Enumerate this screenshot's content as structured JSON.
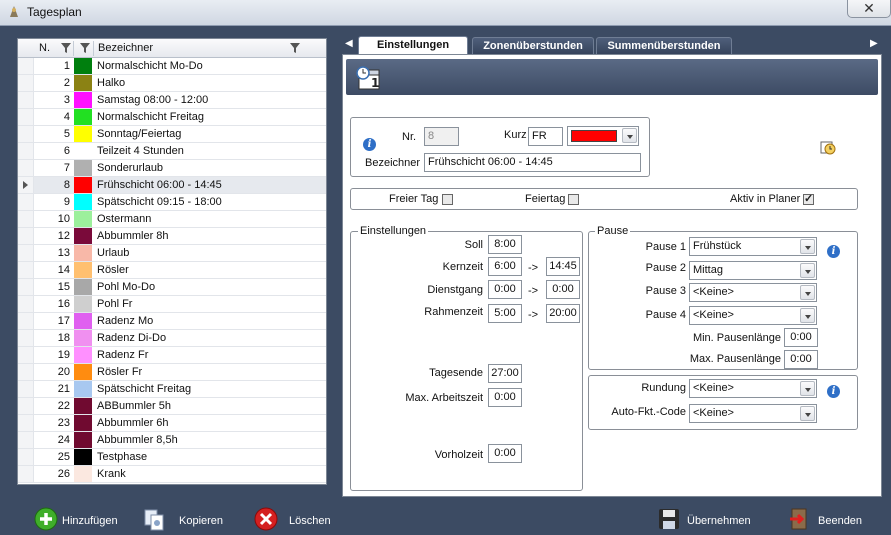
{
  "window": {
    "title": "Tagesplan",
    "close": "✕"
  },
  "grid": {
    "columns": {
      "nr": "N.",
      "name": "Bezeichner"
    },
    "rows": [
      {
        "nr": "1",
        "name": "Normalschicht Mo-Do",
        "color": "#007f0e"
      },
      {
        "nr": "2",
        "name": "Halko",
        "color": "#8b8214"
      },
      {
        "nr": "3",
        "name": "Samstag 08:00 - 12:00",
        "color": "#ff10ff"
      },
      {
        "nr": "4",
        "name": "Normalschicht Freitag",
        "color": "#22e022"
      },
      {
        "nr": "5",
        "name": "Sonntag/Feiertag",
        "color": "#ffff00"
      },
      {
        "nr": "6",
        "name": "Teilzeit 4 Stunden",
        "color": "#ffffff"
      },
      {
        "nr": "7",
        "name": "Sonderurlaub",
        "color": "#b0b0b0"
      },
      {
        "nr": "8",
        "name": "Frühschicht 06:00 - 14:45",
        "color": "#ff0000"
      },
      {
        "nr": "9",
        "name": "Spätschicht 09:15 - 18:00",
        "color": "#00ffff"
      },
      {
        "nr": "10",
        "name": "Ostermann",
        "color": "#9cf09c"
      },
      {
        "nr": "12",
        "name": "Abbummler 8h",
        "color": "#7a0a3a"
      },
      {
        "nr": "13",
        "name": "Urlaub",
        "color": "#f8b8a8"
      },
      {
        "nr": "14",
        "name": "Rösler",
        "color": "#ffc070"
      },
      {
        "nr": "15",
        "name": "Pohl Mo-Do",
        "color": "#a8a8a8"
      },
      {
        "nr": "16",
        "name": "Pohl Fr",
        "color": "#cfcfcf"
      },
      {
        "nr": "17",
        "name": "Radenz Mo",
        "color": "#e060f0"
      },
      {
        "nr": "18",
        "name": "Radenz Di-Do",
        "color": "#f090f0"
      },
      {
        "nr": "19",
        "name": "Radenz Fr",
        "color": "#ff90ff"
      },
      {
        "nr": "20",
        "name": "Rösler Fr",
        "color": "#ff8c10"
      },
      {
        "nr": "21",
        "name": "Spätschicht Freitag",
        "color": "#a8c8f0"
      },
      {
        "nr": "22",
        "name": "ABBummler 5h",
        "color": "#700a30"
      },
      {
        "nr": "23",
        "name": "Abbummler 6h",
        "color": "#700a30"
      },
      {
        "nr": "24",
        "name": "Abbummler 8,5h",
        "color": "#700a30"
      },
      {
        "nr": "25",
        "name": "Testphase",
        "color": "#000000"
      },
      {
        "nr": "26",
        "name": "Krank",
        "color": "#fbe8e0"
      }
    ]
  },
  "tabs": [
    "Einstellungen",
    "Zonenüberstunden",
    "Summenüberstunden"
  ],
  "form": {
    "nr_label": "Nr.",
    "nr_value": "8",
    "kurz_label": "Kurz",
    "kurz_value": "FR",
    "kurz_color": "#ff0000",
    "bez_label": "Bezeichner",
    "bez_value": "Frühschicht 06:00 - 14:45",
    "freier_tag": "Freier Tag",
    "feiertag": "Feiertag",
    "aktiv": "Aktiv in Planer"
  },
  "einstellungen": {
    "legend": "Einstellungen",
    "soll_label": "Soll",
    "soll": "8:00",
    "kernzeit_label": "Kernzeit",
    "kern_from": "6:00",
    "kern_to": "14:45",
    "dienstgang_label": "Dienstgang",
    "dienst_from": "0:00",
    "dienst_to": "0:00",
    "rahmen_label": "Rahmenzeit",
    "rahmen_from": "5:00",
    "rahmen_to": "20:00",
    "arrow": "->",
    "tagesende_label": "Tagesende",
    "tagesende": "27:00",
    "maxarb_label": "Max. Arbeitszeit",
    "maxarb": "0:00",
    "vorholzeit_label": "Vorholzeit",
    "vorholzeit": "0:00"
  },
  "pause": {
    "legend": "Pause",
    "p1_label": "Pause 1",
    "p1": "Frühstück",
    "p2_label": "Pause 2",
    "p2": "Mittag",
    "p3_label": "Pause 3",
    "p3": "<Keine>",
    "p4_label": "Pause 4",
    "p4": "<Keine>",
    "min_label": "Min. Pausenlänge",
    "min": "0:00",
    "max_label": "Max. Pausenlänge",
    "max": "0:00"
  },
  "rundung": {
    "label": "Rundung",
    "value": "<Keine>",
    "auto_label": "Auto-Fkt.-Code",
    "auto_value": "<Keine>"
  },
  "footer": {
    "add": "Hinzufügen",
    "copy": "Kopieren",
    "delete": "Löschen",
    "apply": "Übernehmen",
    "exit": "Beenden"
  }
}
